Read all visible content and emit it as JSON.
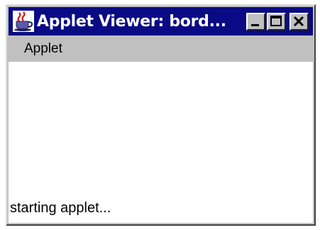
{
  "window": {
    "title": "Applet Viewer: bord...",
    "icon": "java-cup-icon",
    "controls": [
      "minimize-icon",
      "maximize-icon",
      "close-icon"
    ]
  },
  "menubar": {
    "items": [
      {
        "label": "Applet"
      }
    ]
  },
  "status": {
    "text": "starting applet..."
  },
  "colors": {
    "titlebar": "#0a0a84",
    "chrome": "#c0c0c0",
    "content": "#ffffff"
  }
}
